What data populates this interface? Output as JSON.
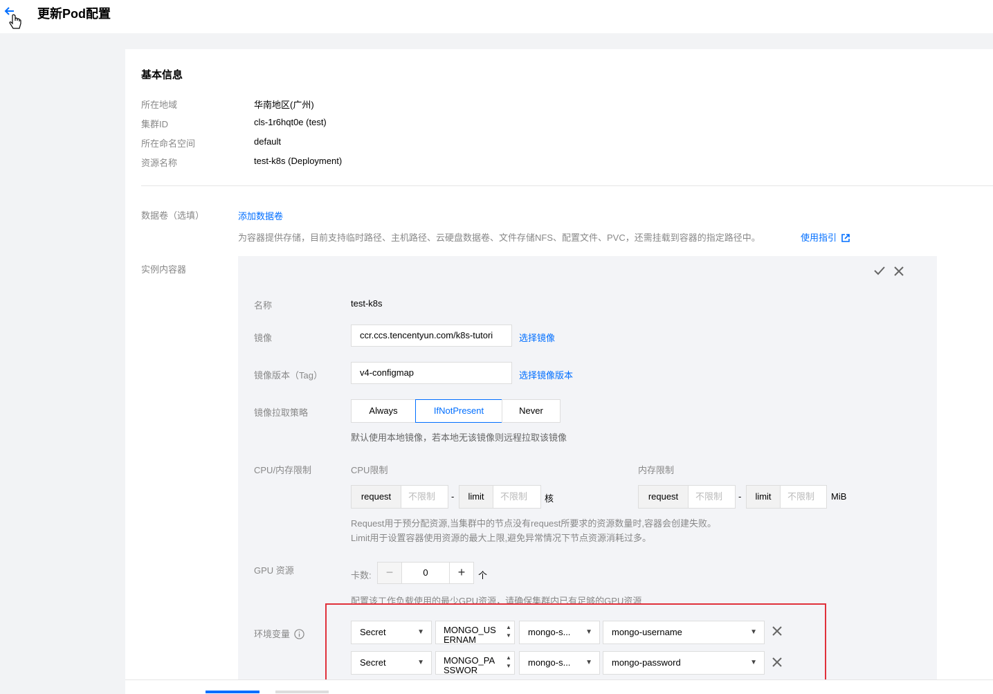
{
  "header": {
    "title": "更新Pod配置"
  },
  "basic_info": {
    "title": "基本信息",
    "rows": [
      {
        "label": "所在地域",
        "value": "华南地区(广州)"
      },
      {
        "label": "集群ID",
        "value": "cls-1r6hqt0e (test)"
      },
      {
        "label": "所在命名空间",
        "value": "default"
      },
      {
        "label": "资源名称",
        "value": "test-k8s (Deployment)"
      }
    ]
  },
  "volumes": {
    "label": "数据卷（选填）",
    "add_link": "添加数据卷",
    "hint": "为容器提供存储，目前支持临时路径、主机路径、云硬盘数据卷、文件存储NFS、配置文件、PVC，还需挂载到容器的指定路径中。",
    "guide_link": "使用指引"
  },
  "containers": {
    "label": "实例内容器",
    "name_label": "名称",
    "name_value": "test-k8s",
    "image_label": "镜像",
    "image_value": "ccr.ccs.tencentyun.com/k8s-tutori",
    "select_image": "选择镜像",
    "tag_label": "镜像版本（Tag）",
    "tag_value": "v4-configmap",
    "select_tag": "选择镜像版本",
    "pull_label": "镜像拉取策略",
    "pull_options": [
      "Always",
      "IfNotPresent",
      "Never"
    ],
    "pull_selected": "IfNotPresent",
    "pull_hint": "默认使用本地镜像，若本地无该镜像则远程拉取该镜像",
    "limits_label": "CPU/内存限制",
    "cpu": {
      "title": "CPU限制",
      "request": "request",
      "limit": "limit",
      "placeholder": "不限制",
      "unit": "核",
      "dash": "-"
    },
    "mem": {
      "title": "内存限制",
      "request": "request",
      "limit": "limit",
      "placeholder": "不限制",
      "unit": "MiB",
      "dash": "-"
    },
    "limits_hint1": "Request用于预分配资源,当集群中的节点没有request所要求的资源数量时,容器会创建失败。",
    "limits_hint2": "Limit用于设置容器使用资源的最大上限,避免异常情况下节点资源消耗过多。",
    "gpu_label": "GPU 资源",
    "gpu_card_label": "卡数:",
    "gpu_value": "0",
    "gpu_unit": "个",
    "gpu_hint": "配置该工作负载使用的最少GPU资源，请确保集群内已有足够的GPU资源",
    "env_label": "环境变量",
    "env_rows": [
      {
        "type": "Secret",
        "key": "MONGO_USERNAM",
        "resource": "mongo-s...",
        "item": "mongo-username"
      },
      {
        "type": "Secret",
        "key": "MONGO_PASSWOR",
        "resource": "mongo-s...",
        "item": "mongo-password"
      }
    ]
  },
  "colors": {
    "accent": "#006eff",
    "highlight_box": "#e0303a"
  }
}
